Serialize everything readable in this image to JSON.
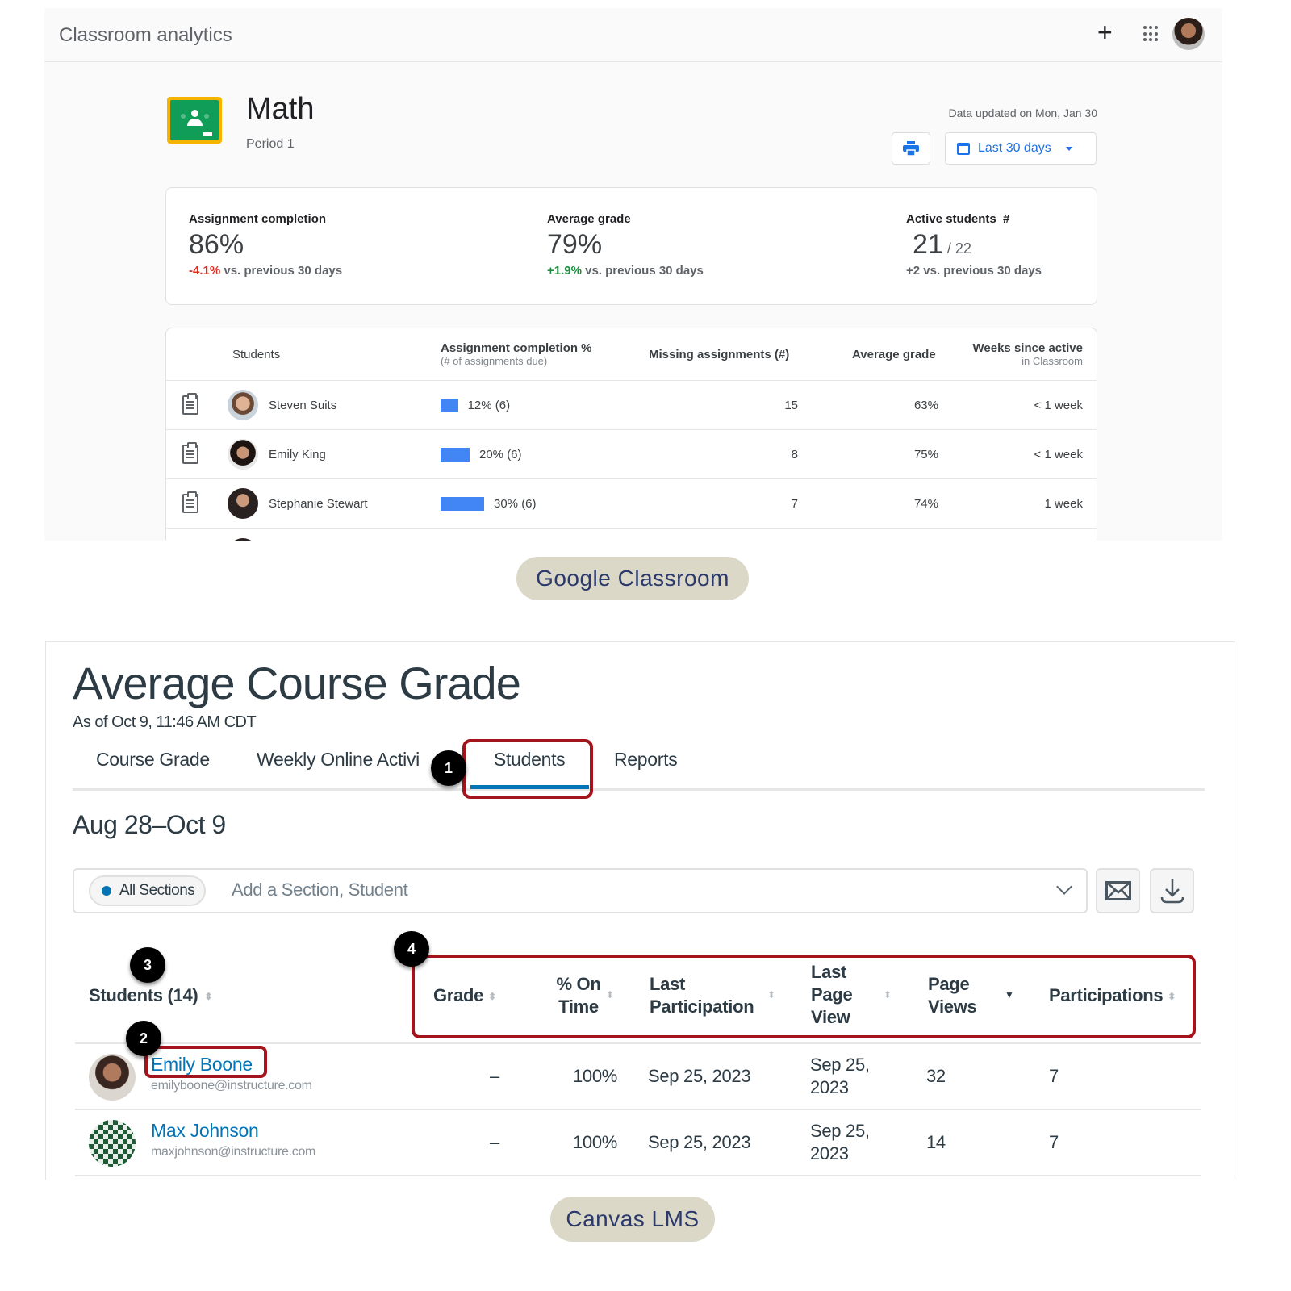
{
  "google_classroom": {
    "header": {
      "title": "Classroom analytics",
      "add_icon": "plus-icon",
      "apps_icon": "apps-grid-icon",
      "avatar_icon": "user-avatar"
    },
    "course": {
      "name": "Math",
      "section": "Period 1",
      "data_updated": "Data updated on Mon, Jan 30",
      "print_icon": "print-icon",
      "range_label": "Last 30 days"
    },
    "stats": [
      {
        "label": "Assignment completion",
        "value": "86%",
        "change": "-4.1%",
        "change_suffix": " vs. previous 30 days",
        "change_color": "#d93025"
      },
      {
        "label": "Average grade",
        "value": "79%",
        "change": "+1.9%",
        "change_suffix": " vs. previous 30 days",
        "change_color": "#1e8e3e"
      },
      {
        "label": "Active students  #",
        "value": "21",
        "value_total": " / 22",
        "change": "+2",
        "change_suffix": " vs. previous 30 days"
      }
    ],
    "table": {
      "columns": [
        {
          "label": "Students",
          "sub": ""
        },
        {
          "label": "Assignment completion %",
          "sub": "(# of assignments due)"
        },
        {
          "label": "Missing assignments (#)",
          "sub": ""
        },
        {
          "label": "Average grade",
          "sub": ""
        },
        {
          "label": "Weeks since active",
          "sub": "in Classroom"
        }
      ],
      "rows": [
        {
          "name": "Steven Suits",
          "completion_pct": 12,
          "completion": "12% (6)",
          "missing": "15",
          "avg_grade": "63%",
          "weeks_active": "< 1 week"
        },
        {
          "name": "Emily King",
          "completion_pct": 20,
          "completion": "20% (6)",
          "missing": "8",
          "avg_grade": "75%",
          "weeks_active": "< 1 week"
        },
        {
          "name": "Stephanie Stewart",
          "completion_pct": 30,
          "completion": "30% (6)",
          "missing": "7",
          "avg_grade": "74%",
          "weeks_active": "1 week"
        }
      ]
    },
    "bar_color": "#4285f4"
  },
  "labels": {
    "google": "Google Classroom",
    "canvas": "Canvas LMS"
  },
  "canvas": {
    "title": "Average Course Grade",
    "as_of": "As of Oct 9, 11:46 AM CDT",
    "tabs": [
      {
        "label": "Course Grade",
        "active": false
      },
      {
        "label": "Weekly Online Activi",
        "active": false
      },
      {
        "label": "Students",
        "active": true
      },
      {
        "label": "Reports",
        "active": false
      }
    ],
    "date_range": "Aug 28–Oct 9",
    "filter": {
      "chip": "All Sections",
      "placeholder": "Add a Section, Student"
    },
    "badges": [
      "1",
      "2",
      "3",
      "4"
    ],
    "table": {
      "student_header": "Students (14)",
      "columns": [
        {
          "label": "Grade",
          "sort": "both"
        },
        {
          "label": "% On Time",
          "sort": "both"
        },
        {
          "label": "Last Participation",
          "sort": "both"
        },
        {
          "label": "Last Page View",
          "sort": "both"
        },
        {
          "label": "Page Views",
          "sort": "desc"
        },
        {
          "label": "Participations",
          "sort": "both"
        }
      ],
      "rows": [
        {
          "name": "Emily Boone",
          "email": "emilyboone@instructure.com",
          "grade": "–",
          "on_time": "100%",
          "last_participation": "Sep 25, 2023",
          "last_page_view": "Sep 25, 2023",
          "page_views": "32",
          "participations": "7"
        },
        {
          "name": "Max Johnson",
          "email": "maxjohnson@instructure.com",
          "grade": "–",
          "on_time": "100%",
          "last_participation": "Sep 25, 2023",
          "last_page_view": "Sep 25, 2023",
          "page_views": "14",
          "participations": "7"
        }
      ]
    },
    "accent_color": "#0374b5",
    "highlight_color": "#a4141c"
  }
}
